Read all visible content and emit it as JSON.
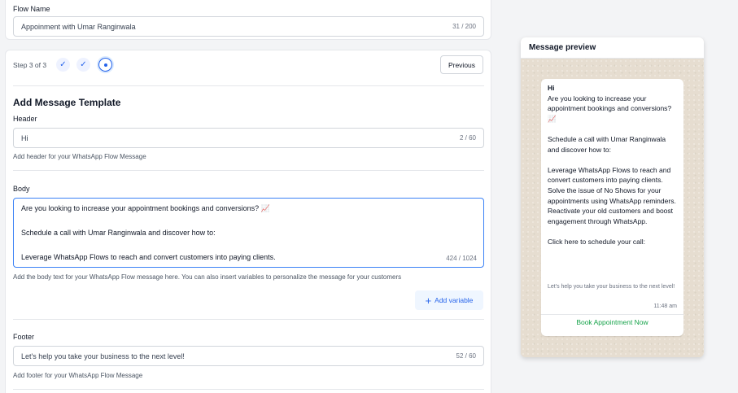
{
  "flow": {
    "label": "Flow Name",
    "value": "Appoinment with Umar Ranginwala",
    "counter": "31 / 200"
  },
  "steps": {
    "text": "Step 3 of 3",
    "done_glyph": "✓",
    "previous_label": "Previous"
  },
  "template": {
    "title": "Add Message Template",
    "header": {
      "label": "Header",
      "value": "Hi",
      "counter": "2 / 60",
      "help": "Add header for your WhatsApp Flow Message"
    },
    "body": {
      "label": "Body",
      "lines": [
        "Are you looking to increase your appointment bookings and conversions? 📈",
        "Schedule a call with Umar Ranginwala and discover how to:",
        "Leverage WhatsApp Flows to reach and convert customers into paying clients."
      ],
      "counter": "424 / 1024",
      "help": "Add the body text for your WhatsApp Flow message here. You can also insert variables to personalize the message for your customers",
      "add_variable_label": "Add variable",
      "add_variable_icon": "+"
    },
    "footer": {
      "label": "Footer",
      "value": "Let's help you take your business to the next level!",
      "counter": "52 / 60",
      "help": "Add footer for your WhatsApp Flow Message"
    }
  },
  "preview": {
    "title": "Message preview",
    "header": "Hi",
    "paragraphs": [
      "Are you looking to increase your appointment bookings and conversions? 📈",
      "Schedule a call with Umar Ranginwala and discover how to:",
      "Leverage WhatsApp Flows to reach and convert customers into paying clients.\nSolve the issue of No Shows for your appointments using WhatsApp reminders.\nReactivate your old customers and boost engagement through WhatsApp.",
      "Click here to schedule your call:"
    ],
    "footer": "Let's help you take your business to the next level!",
    "time": "11:48 am",
    "cta": "Book Appointment Now"
  }
}
